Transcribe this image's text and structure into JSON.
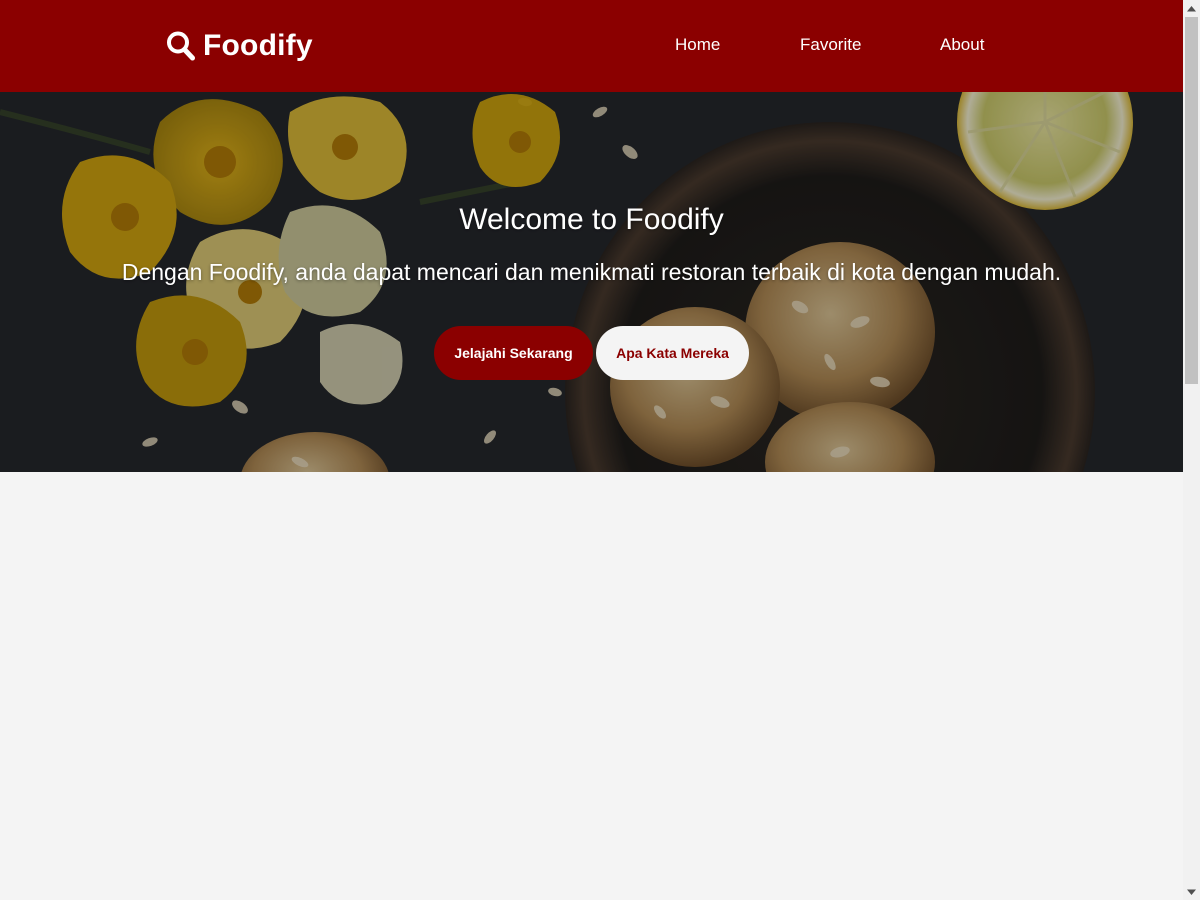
{
  "header": {
    "brand": {
      "icon": "search-icon",
      "name": "Foodify"
    },
    "nav": [
      {
        "label": "Home"
      },
      {
        "label": "Favorite"
      },
      {
        "label": "About"
      }
    ],
    "background_color": "#8b0000"
  },
  "hero": {
    "title": "Welcome to Foodify",
    "subtitle": "Dengan Foodify, anda dapat mencari dan menikmati restoran terbaik di kota dengan mudah.",
    "primary_button": "Jelajahi Sekarang",
    "secondary_button": "Apa Kata Mereka",
    "background_image": "food-hero-image"
  },
  "colors": {
    "accent": "#8b0000",
    "page_background": "#f4f4f4",
    "text_light": "#ffffff"
  },
  "scrollbar": {
    "up_icon": "scroll-up-arrow-icon",
    "down_icon": "scroll-down-arrow-icon"
  }
}
